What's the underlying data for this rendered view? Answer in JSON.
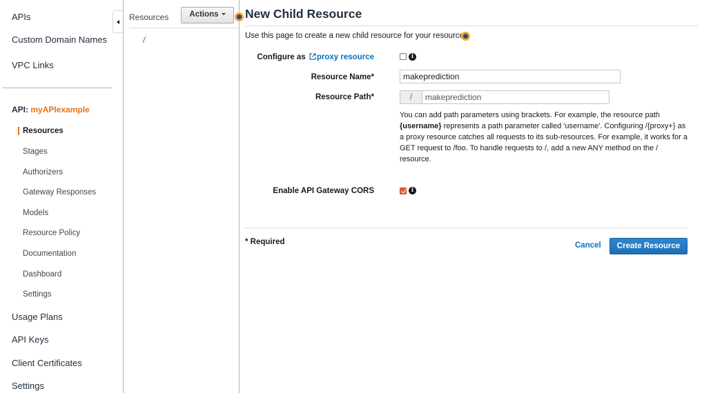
{
  "sidebar": {
    "top_items": [
      {
        "label": "APIs"
      },
      {
        "label": "Custom Domain Names"
      },
      {
        "label": "VPC Links"
      }
    ],
    "api_prefix": "API:",
    "api_name": "myAPIexample",
    "api_items": [
      {
        "label": "Resources",
        "active": true
      },
      {
        "label": "Stages"
      },
      {
        "label": "Authorizers"
      },
      {
        "label": "Gateway Responses"
      },
      {
        "label": "Models"
      },
      {
        "label": "Resource Policy"
      },
      {
        "label": "Documentation"
      },
      {
        "label": "Dashboard"
      },
      {
        "label": "Settings"
      }
    ],
    "bottom_items": [
      {
        "label": "Usage Plans"
      },
      {
        "label": "API Keys"
      },
      {
        "label": "Client Certificates"
      },
      {
        "label": "Settings"
      }
    ]
  },
  "resources_panel": {
    "label": "Resources",
    "actions_label": "Actions",
    "root_path": "/"
  },
  "form": {
    "title": "New Child Resource",
    "intro": "Use this page to create a new child resource for your resource.",
    "proxy": {
      "label_prefix": "Configure as",
      "link_text": "proxy resource",
      "checked": false
    },
    "resource_name": {
      "label": "Resource Name*",
      "value": "makeprediction"
    },
    "resource_path": {
      "label": "Resource Path*",
      "prefix": "/",
      "value": "makeprediction"
    },
    "help": {
      "part1": "You can add path parameters using brackets. For example, the resource path ",
      "bold": "{username}",
      "part2": " represents a path parameter called 'username'. Configuring /{proxy+} as a proxy resource catches all requests to its sub-resources. For example, it works for a GET request to /foo. To handle requests to /, add a new ANY method on the / resource."
    },
    "cors": {
      "label": "Enable API Gateway CORS",
      "checked": true
    },
    "required_note": "* Required",
    "cancel_label": "Cancel",
    "create_label": "Create Resource"
  },
  "colors": {
    "accent": "#ec7211",
    "link": "#0073bb",
    "primary_button": "#1f6fb5",
    "checkbox_checked": "#e0612a"
  }
}
